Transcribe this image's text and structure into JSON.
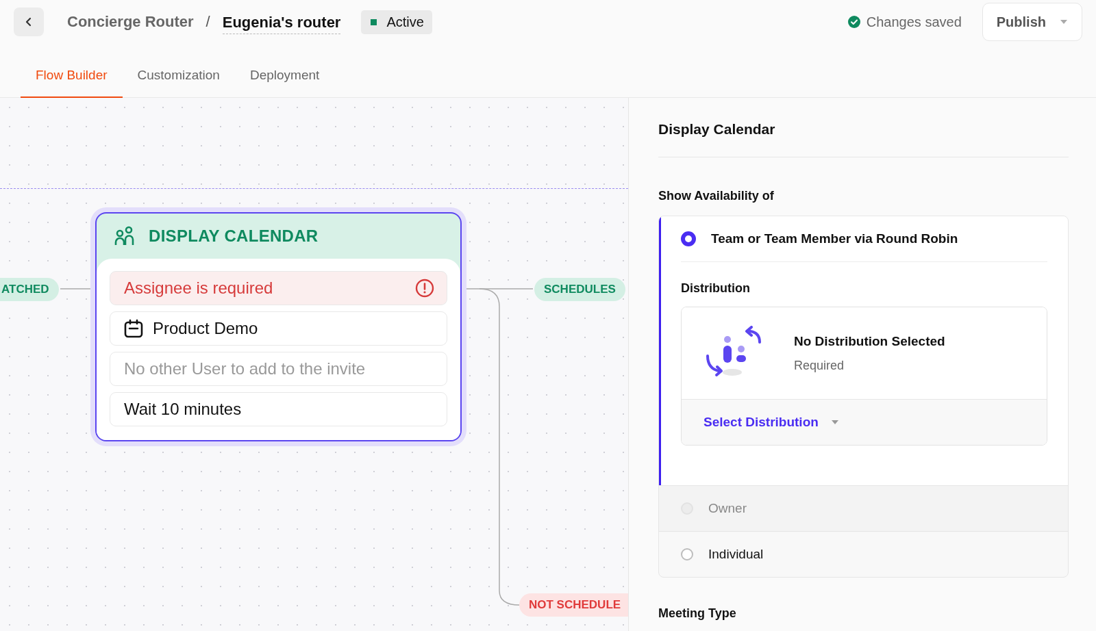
{
  "header": {
    "breadcrumb": [
      {
        "label": "Concierge Router",
        "current": false
      },
      {
        "label": "Eugenia's router",
        "current": true
      }
    ],
    "separator": "/",
    "status": {
      "label": "Active",
      "color": "#0f8a5f"
    },
    "save_state": "Changes saved",
    "publish": "Publish"
  },
  "tabs": [
    {
      "label": "Flow Builder",
      "selected": true
    },
    {
      "label": "Customization",
      "selected": false
    },
    {
      "label": "Deployment",
      "selected": false
    }
  ],
  "canvas": {
    "incoming_label": "ATCHED",
    "node": {
      "title": "DISPLAY CALENDAR",
      "alert": "Assignee is required",
      "items": [
        {
          "kind": "meeting",
          "text": "Product Demo"
        },
        {
          "kind": "placeholder",
          "text": "No other User to add to the invite"
        },
        {
          "kind": "plain",
          "text": "Wait 10 minutes"
        }
      ]
    },
    "outputs": [
      {
        "label": "SCHEDULES",
        "kind": "success"
      },
      {
        "label": "NOT SCHEDULE",
        "kind": "failure"
      }
    ]
  },
  "panel": {
    "title": "Display Calendar",
    "section": "Show Availability of",
    "options": [
      {
        "label": "Team or Team Member via Round Robin",
        "selected": true,
        "disabled": false
      },
      {
        "label": "Owner",
        "selected": false,
        "disabled": true
      },
      {
        "label": "Individual",
        "selected": false,
        "disabled": false
      }
    ],
    "distribution": {
      "label": "Distribution",
      "title": "No Distribution Selected",
      "subtitle": "Required",
      "select": "Select Distribution"
    },
    "next_section": "Meeting Type"
  }
}
